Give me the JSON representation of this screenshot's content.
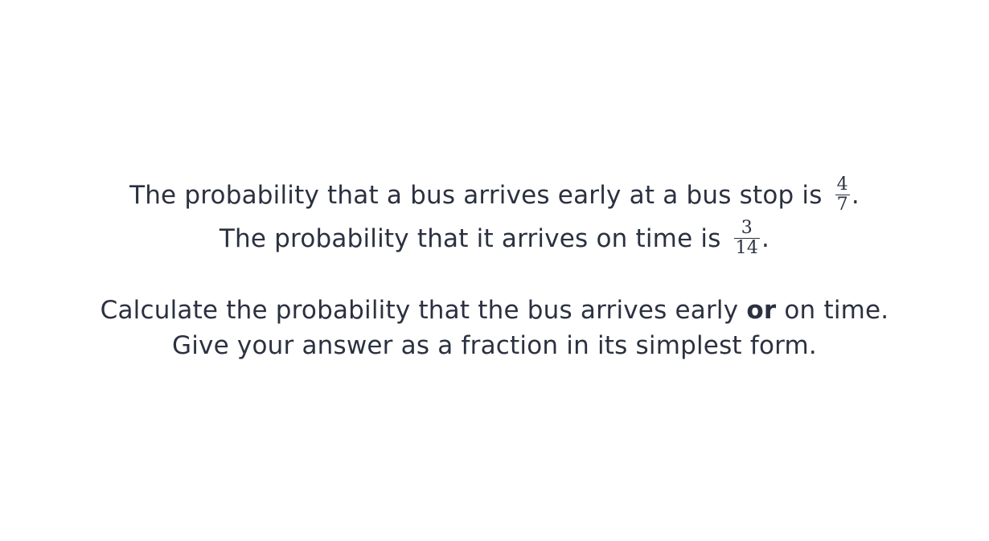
{
  "question": {
    "line1": {
      "text": "The probability that a bus arrives early at a bus stop is",
      "fraction": {
        "numerator": "4",
        "denominator": "7"
      },
      "end": "."
    },
    "line2": {
      "text": "The probability that it arrives on time is",
      "fraction": {
        "numerator": "3",
        "denominator": "14"
      },
      "end": "."
    },
    "line3": {
      "before": "Calculate the probability that the bus arrives early",
      "emphasis": "or",
      "after": "on time."
    },
    "line4": {
      "text": "Give your answer as a fraction in its simplest form."
    }
  },
  "colors": {
    "text": "#2b3140",
    "background": "#ffffff"
  }
}
